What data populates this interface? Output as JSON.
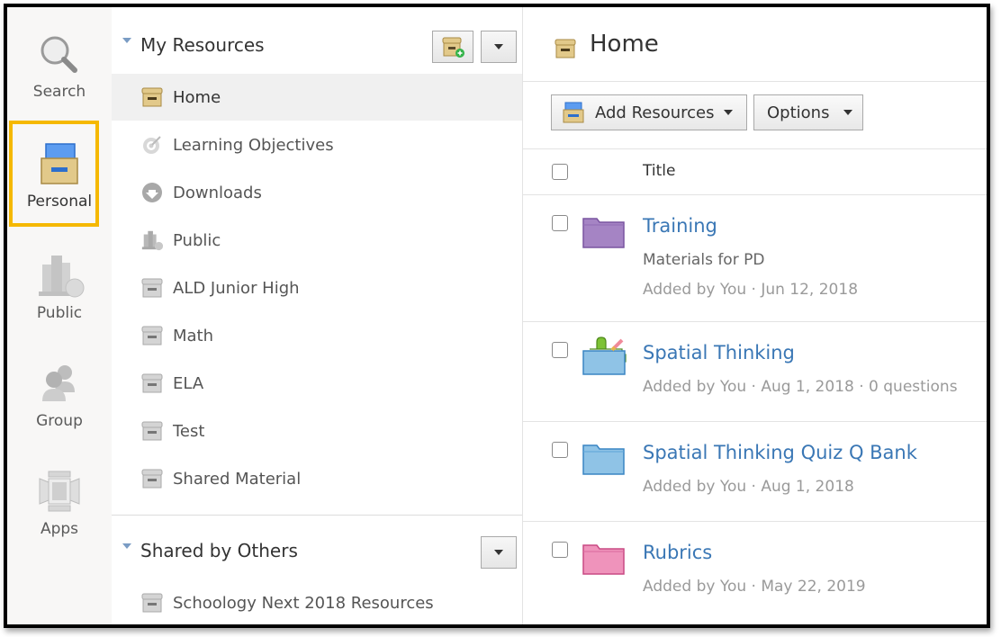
{
  "rail": {
    "items": [
      {
        "label": "Search",
        "icon": "search-icon"
      },
      {
        "label": "Personal",
        "icon": "personal-box-icon",
        "active": true
      },
      {
        "label": "Public",
        "icon": "public-library-icon"
      },
      {
        "label": "Group",
        "icon": "group-people-icon"
      },
      {
        "label": "Apps",
        "icon": "apps-icon"
      }
    ],
    "highlight_color": "#f5b800"
  },
  "nav": {
    "my_resources": {
      "title": "My Resources",
      "items": [
        {
          "label": "Home",
          "icon": "home-box-icon",
          "selected": true
        },
        {
          "label": "Learning Objectives",
          "icon": "target-icon"
        },
        {
          "label": "Downloads",
          "icon": "download-icon"
        },
        {
          "label": "Public",
          "icon": "public-library-icon"
        },
        {
          "label": "ALD Junior High",
          "icon": "collection-box-icon"
        },
        {
          "label": "Math",
          "icon": "collection-box-icon"
        },
        {
          "label": "ELA",
          "icon": "collection-box-icon"
        },
        {
          "label": "Test",
          "icon": "collection-box-icon"
        },
        {
          "label": "Shared Material",
          "icon": "collection-box-icon"
        }
      ]
    },
    "shared_by_others": {
      "title": "Shared by Others",
      "items": [
        {
          "label": "Schoology Next 2018 Resources",
          "icon": "collection-box-icon"
        }
      ]
    }
  },
  "main": {
    "title": "Home",
    "toolbar": {
      "add_resources_label": "Add Resources",
      "options_label": "Options"
    },
    "table": {
      "column_title": "Title",
      "rows": [
        {
          "title": "Training",
          "subtitle": "Materials for PD",
          "meta": "Added by You · Jun 12, 2018",
          "folder_color": "#a584c4",
          "type": "folder"
        },
        {
          "title": "Spatial Thinking",
          "meta": "Added by You · Aug 1, 2018 · 0 questions",
          "folder_color": "#8fc3e6",
          "type": "question-bank"
        },
        {
          "title": "Spatial Thinking Quiz Q Bank",
          "meta": "Added by You · Aug 1, 2018",
          "folder_color": "#8fc3e6",
          "type": "folder"
        },
        {
          "title": "Rubrics",
          "meta": "Added by You · May 22, 2019",
          "folder_color": "#ef93bb",
          "type": "folder"
        }
      ]
    }
  },
  "colors": {
    "link": "#3a77b5",
    "box_tan": "#e2c98a",
    "box_gray": "#c8c8c8"
  }
}
